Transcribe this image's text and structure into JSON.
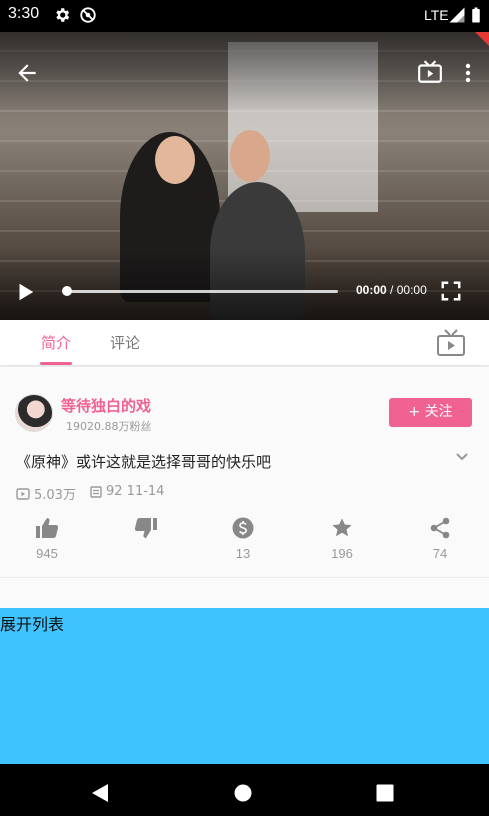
{
  "status_bar": {
    "time": "3:30",
    "network": "LTE",
    "icons": [
      "gear-icon",
      "do-not-disturb-icon",
      "signal-icon",
      "battery-icon"
    ]
  },
  "player": {
    "current_time": "00:00",
    "separator": " / ",
    "total_time": "00:00",
    "progress_fraction": 0,
    "icons": [
      "back-arrow-icon",
      "tv-cast-icon",
      "more-vertical-icon",
      "play-icon",
      "fullscreen-icon"
    ]
  },
  "tabs": {
    "intro": "简介",
    "comments": "评论",
    "active": "intro"
  },
  "uploader": {
    "name": "等待独白的戏",
    "fans": "19020.88万粉丝",
    "follow_label": "+ 关注"
  },
  "video": {
    "title": "《原神》或许这就是选择哥哥的快乐吧",
    "views": "5.03万",
    "danmaku_date": "92 11-14"
  },
  "actions": {
    "like": "945",
    "dislike": "",
    "coin": "13",
    "favorite": "196",
    "share": "74"
  },
  "list_panel": {
    "expand_label": "展开列表"
  },
  "colors": {
    "accent": "#f06292",
    "panel": "#40c4ff",
    "muted": "#999999"
  }
}
